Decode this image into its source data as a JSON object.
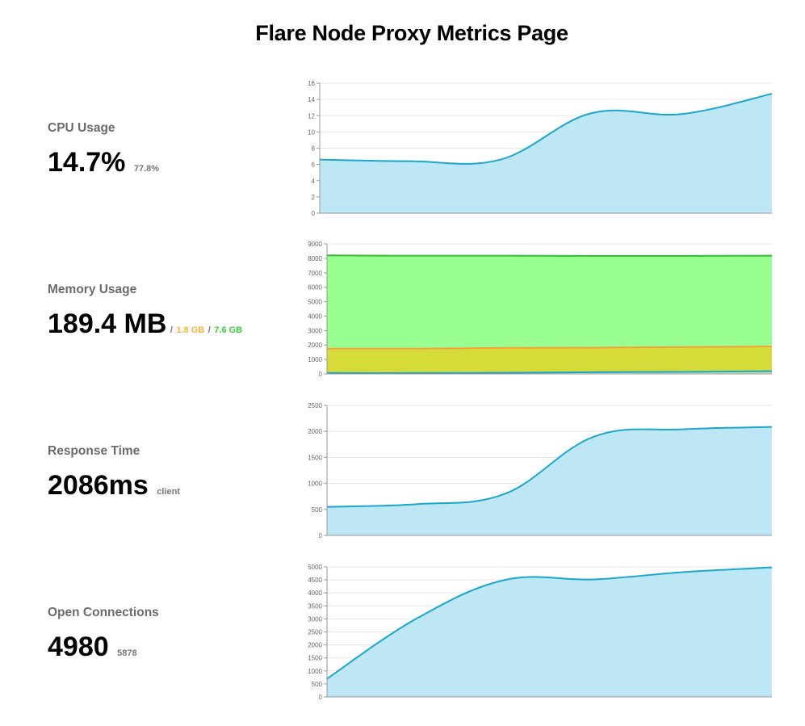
{
  "page": {
    "title": "Flare Node Proxy Metrics Page"
  },
  "metrics": [
    {
      "label": "CPU Usage",
      "value": "14.7%",
      "sub": "77.8%"
    },
    {
      "label": "Memory Usage",
      "value": "189.4 MB",
      "sep1": "/",
      "sub_orange": "1.8 GB",
      "sep2": "/",
      "sub_green": "7.6 GB"
    },
    {
      "label": "Response Time",
      "value": "2086ms",
      "sub": "client"
    },
    {
      "label": "Open Connections",
      "value": "4980",
      "sub": "5878"
    }
  ],
  "colors": {
    "line": "#1ba6cd",
    "fill": "#bde7f4",
    "memory_total": "#99ff90",
    "memory_total_line": "#33bb33",
    "memory_system": "#d5dc3a",
    "memory_system_line": "#f6a03c",
    "grid": "#e6e6e6"
  },
  "chart_data": [
    {
      "type": "area",
      "x": [
        0,
        1,
        2,
        3,
        4,
        5
      ],
      "ylim": [
        0,
        16
      ],
      "yticks": [
        "0",
        "2",
        "4",
        "6",
        "8",
        "10",
        "12",
        "14",
        "16"
      ],
      "series": [
        {
          "values": [
            6.6,
            6.4,
            6.6,
            12.3,
            12.2,
            14.7
          ]
        }
      ]
    },
    {
      "type": "area",
      "x": [
        0,
        1,
        2,
        3,
        4,
        5
      ],
      "ylim": [
        0,
        9000
      ],
      "yticks": [
        "0",
        "1000",
        "2000",
        "3000",
        "4000",
        "5000",
        "6000",
        "7000",
        "8000",
        "9000"
      ],
      "series": [
        {
          "values": [
            8200,
            8180,
            8180,
            8170,
            8170,
            8180
          ]
        },
        {
          "values": [
            1750,
            1750,
            1800,
            1820,
            1860,
            1900
          ]
        },
        {
          "values": [
            60,
            60,
            80,
            120,
            140,
            189
          ]
        }
      ]
    },
    {
      "type": "area",
      "x": [
        0,
        1,
        2,
        3,
        4,
        5
      ],
      "ylim": [
        0,
        2500
      ],
      "yticks": [
        "0",
        "500",
        "1000",
        "1500",
        "2000",
        "2500"
      ],
      "series": [
        {
          "values": [
            550,
            600,
            800,
            1900,
            2040,
            2086
          ]
        }
      ]
    },
    {
      "type": "area",
      "x": [
        0,
        1,
        2,
        3,
        4,
        5
      ],
      "ylim": [
        0,
        5000
      ],
      "yticks": [
        "0",
        "500",
        "1000",
        "1500",
        "2000",
        "2500",
        "3000",
        "3500",
        "4000",
        "4500",
        "5000"
      ],
      "series": [
        {
          "values": [
            700,
            3000,
            4500,
            4520,
            4800,
            4980
          ]
        }
      ]
    }
  ]
}
